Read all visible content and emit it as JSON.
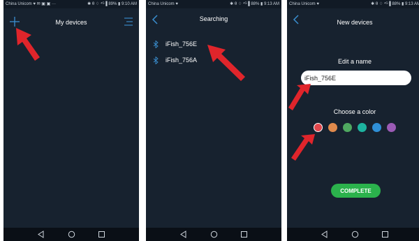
{
  "screens": [
    {
      "status": {
        "carrier": "China Unicom ♥ ✉ ▣ ▣ ···",
        "right": "✱ θ ♢ ⁴ᴳ▐ 89% ▮ 9:10 AM"
      },
      "title": "My devices",
      "icons": {
        "left": "plus-icon",
        "right": "menu-icon"
      }
    },
    {
      "status": {
        "carrier": "China Unicom ♥",
        "right": "✱ θ ♢ ⁴ᴳ▐ 88% ▮ 9:13 AM"
      },
      "title": "Searching",
      "devices": [
        {
          "name": "iFish_756E"
        },
        {
          "name": "iFish_756A"
        }
      ]
    },
    {
      "status": {
        "carrier": "China Unicom ♥",
        "right": "✱ θ ♢ ⁴ᴳ▐ 88% ▮ 9:13 AM"
      },
      "title": "New devices",
      "edit_label": "Edit a name",
      "name_value": "iFish_756E",
      "color_label": "Choose a color",
      "colors": [
        "#e0474c",
        "#e08a4c",
        "#4fa860",
        "#1db3a0",
        "#2f8fd6",
        "#9b5bb5"
      ],
      "selected_color": 0,
      "complete_label": "COMPLETE"
    }
  ],
  "theme": {
    "background": "#17222f",
    "accent": "#2bb24c",
    "arrow": "#e0252b"
  }
}
